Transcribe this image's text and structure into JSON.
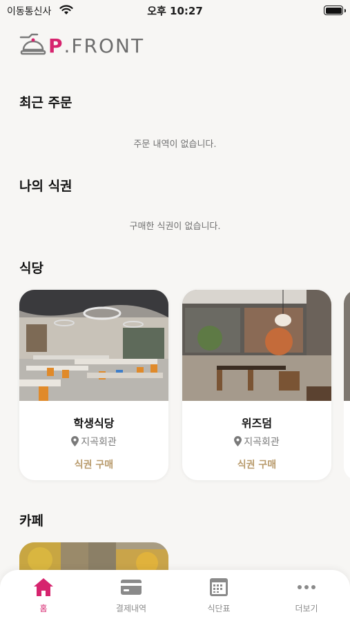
{
  "status_bar": {
    "carrier": "이동통신사",
    "time": "오후 10:27"
  },
  "logo": {
    "text_p": "P",
    "text_rest": ".FRONT"
  },
  "recent_orders": {
    "title": "최근 주문",
    "empty_message": "주문 내역이 없습니다."
  },
  "my_tickets": {
    "title": "나의 식권",
    "empty_message": "구매한 식권이 없습니다."
  },
  "restaurants": {
    "title": "식당",
    "items": [
      {
        "name": "학생식당",
        "location": "지곡회관",
        "action": "식권 구매"
      },
      {
        "name": "위즈덤",
        "location": "지곡회관",
        "action": "식권 구매"
      }
    ]
  },
  "cafe": {
    "title": "카페"
  },
  "tab_bar": {
    "items": [
      {
        "label": "홈",
        "icon": "home-icon",
        "active": true
      },
      {
        "label": "결제내역",
        "icon": "card-icon",
        "active": false
      },
      {
        "label": "식단표",
        "icon": "calendar-icon",
        "active": false
      },
      {
        "label": "더보기",
        "icon": "more-icon",
        "active": false
      }
    ]
  },
  "colors": {
    "accent": "#d6246e",
    "buy": "#b89a6b",
    "background": "#f7f6f4"
  }
}
